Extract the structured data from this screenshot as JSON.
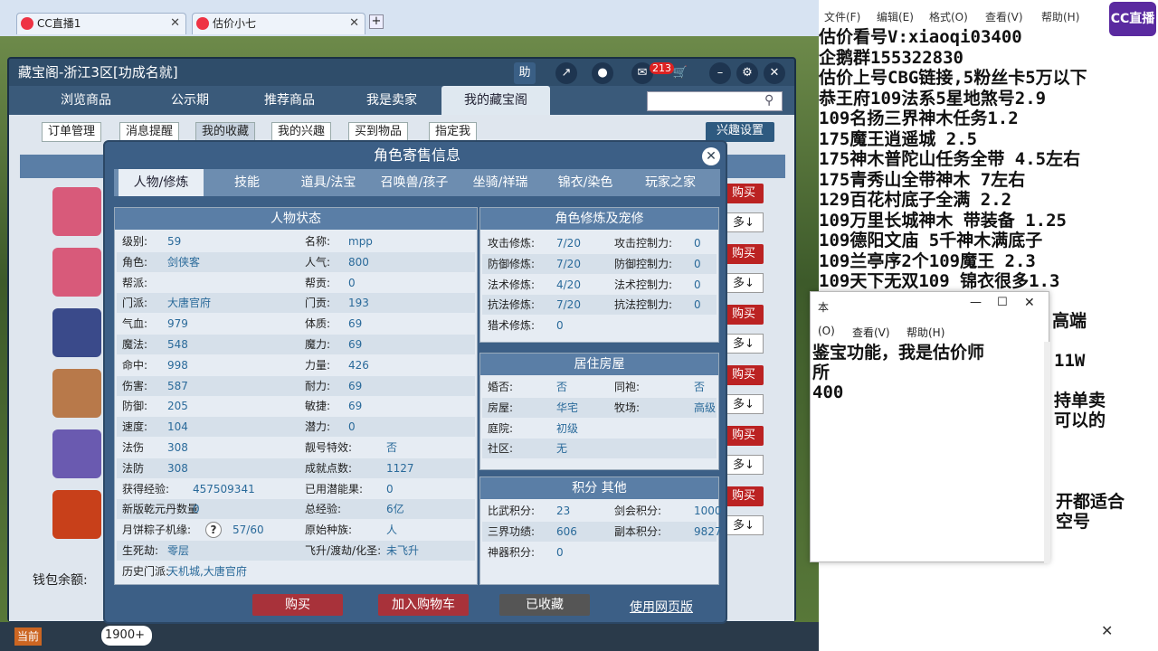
{
  "browser": {
    "tabs": [
      {
        "label": "CC直播1"
      },
      {
        "label": "估价小七"
      }
    ]
  },
  "cbg": {
    "title": "藏宝阁-浙江3区[功成名就]",
    "icons": {
      "help": "助",
      "badge": "213"
    },
    "nav": [
      "浏览商品",
      "公示期",
      "推荐商品",
      "我是卖家",
      "我的藏宝阁"
    ],
    "subnav": [
      "订单管理",
      "消息提醒",
      "我的收藏",
      "我的兴趣",
      "买到物品",
      "指定我"
    ],
    "interest": "兴趣设置",
    "side_buy": "购买",
    "side_more": "多↓",
    "wallet": "钱包余额:"
  },
  "modal": {
    "title": "角色寄售信息",
    "tabs": [
      "人物/修炼",
      "技能",
      "道具/法宝",
      "召唤兽/孩子",
      "坐骑/祥瑞",
      "锦衣/染色",
      "玩家之家"
    ],
    "status": {
      "head": "人物状态",
      "left": [
        [
          "级别:",
          "59"
        ],
        [
          "角色:",
          "剑侠客"
        ],
        [
          "帮派:",
          ""
        ],
        [
          "门派:",
          "大唐官府"
        ],
        [
          "气血:",
          "979"
        ],
        [
          "魔法:",
          "548"
        ],
        [
          "命中:",
          "998"
        ],
        [
          "伤害:",
          "587"
        ],
        [
          "防御:",
          "205"
        ],
        [
          "速度:",
          "104"
        ],
        [
          "法伤",
          "308"
        ],
        [
          "法防",
          "308"
        ],
        [
          "获得经验:",
          "457509341"
        ],
        [
          "新版乾元丹数量",
          "0"
        ],
        [
          "月饼粽子机缘:",
          "57/60"
        ],
        [
          "生死劫:",
          "零层"
        ],
        [
          "历史门派:",
          "天机城,大唐官府"
        ]
      ],
      "right": [
        [
          "名称:",
          "mpp"
        ],
        [
          "人气:",
          "800"
        ],
        [
          "帮贡:",
          "0"
        ],
        [
          "门贡:",
          "193"
        ],
        [
          "体质:",
          "69"
        ],
        [
          "魔力:",
          "69"
        ],
        [
          "力量:",
          "426"
        ],
        [
          "耐力:",
          "69"
        ],
        [
          "敏捷:",
          "69"
        ],
        [
          "潜力:",
          "0"
        ],
        [
          "靓号特效:",
          "否"
        ],
        [
          "成就点数:",
          "1127"
        ],
        [
          "已用潜能果:",
          "0"
        ],
        [
          "总经验:",
          "6亿"
        ],
        [
          "原始种族:",
          "人"
        ],
        [
          "飞升/渡劫/化圣:",
          "未飞升"
        ]
      ]
    },
    "cultivation": {
      "head": "角色修炼及宠修",
      "rows": [
        [
          "攻击修炼:",
          "7/20",
          "攻击控制力:",
          "0"
        ],
        [
          "防御修炼:",
          "7/20",
          "防御控制力:",
          "0"
        ],
        [
          "法术修炼:",
          "4/20",
          "法术控制力:",
          "0"
        ],
        [
          "抗法修炼:",
          "7/20",
          "抗法控制力:",
          "0"
        ],
        [
          "猎术修炼:",
          "0",
          "",
          ""
        ]
      ]
    },
    "house": {
      "head": "居住房屋",
      "rows": [
        [
          "婚否:",
          "否",
          "同袍:",
          "否"
        ],
        [
          "房屋:",
          "华宅",
          "牧场:",
          "高级"
        ],
        [
          "庭院:",
          "初级",
          "",
          ""
        ],
        [
          "社区:",
          "无",
          "",
          ""
        ]
      ]
    },
    "points": {
      "head": "积分 其他",
      "rows": [
        [
          "比武积分:",
          "23",
          "剑会积分:",
          "1000"
        ],
        [
          "三界功绩:",
          "606",
          "副本积分:",
          "9827"
        ],
        [
          "神器积分:",
          "0",
          "",
          ""
        ]
      ]
    },
    "buttons": {
      "buy": "购买",
      "cart": "加入购物车",
      "fav": "已收藏",
      "web": "使用网页版"
    }
  },
  "notepad": {
    "menu": [
      "文件(F)",
      "编辑(E)",
      "格式(O)",
      "查看(V)",
      "帮助(H)"
    ],
    "lines": [
      "估价看号V:xiaoqi03400",
      "企鹅群155322830",
      "估价上号CBG链接,5粉丝卡5万以下",
      "恭王府109法系5星地煞号2.9",
      "109名扬三界神木任务1.2",
      "175魔王逍遥城 2.5",
      "175神木普陀山任务全带 4.5左右",
      "175青秀山全带神木  7左右",
      "129百花村底子全满 2.2",
      "109万里长城神木 带装备  1.25",
      "109德阳文庙 5千神木满底子",
      "109兰亭序2个109魔王 2.3",
      "109天下无双109  锦衣很多1.3"
    ],
    "right_fragments": [
      "高端",
      "11W",
      "持单卖",
      "可以的",
      "开都适合",
      "空号"
    ],
    "np2": {
      "title": "本",
      "menu": [
        "(O)",
        "查看(V)",
        "帮助(H)"
      ],
      "lines": [
        "鉴宝功能，我是估价师",
        "所",
        "400"
      ]
    }
  },
  "logo": "CC直播",
  "bottom": {
    "status": "当前",
    "count": "1900+"
  }
}
